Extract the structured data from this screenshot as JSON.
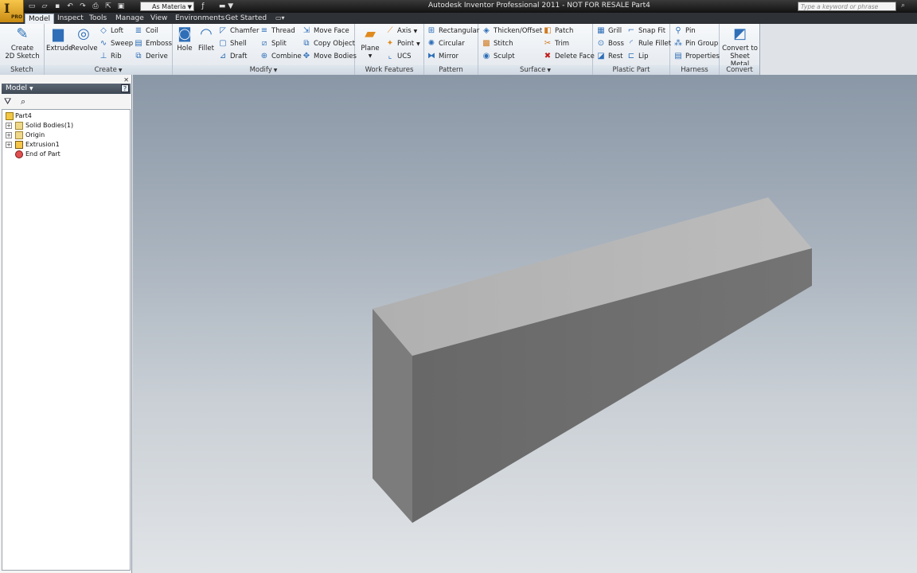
{
  "window": {
    "title": "Autodesk Inventor Professional 2011 - NOT FOR RESALE   Part4",
    "logo_text": "I",
    "logo_sub": "PRO"
  },
  "quick_access": {
    "material": "As Materia",
    "search_placeholder": "Type a keyword or phrase"
  },
  "tabs": [
    "Model",
    "Inspect",
    "Tools",
    "Manage",
    "View",
    "Environments",
    "Get Started"
  ],
  "ribbon": {
    "sketch": {
      "title": "Sketch",
      "create_2d_sketch": "Create\n2D Sketch"
    },
    "create": {
      "title": "Create",
      "extrude": "Extrude",
      "revolve": "Revolve",
      "loft": "Loft",
      "sweep": "Sweep",
      "rib": "Rib",
      "coil": "Coil",
      "emboss": "Emboss",
      "derive": "Derive"
    },
    "modify": {
      "title": "Modify",
      "hole": "Hole",
      "fillet": "Fillet",
      "chamfer": "Chamfer",
      "shell": "Shell",
      "draft": "Draft",
      "thread": "Thread",
      "split": "Split",
      "combine": "Combine",
      "move_face": "Move Face",
      "copy_object": "Copy Object",
      "move_bodies": "Move Bodies"
    },
    "work_features": {
      "title": "Work Features",
      "plane": "Plane",
      "axis": "Axis",
      "point": "Point",
      "ucs": "UCS"
    },
    "pattern": {
      "title": "Pattern",
      "rectangular": "Rectangular",
      "circular": "Circular",
      "mirror": "Mirror"
    },
    "surface": {
      "title": "Surface",
      "thicken_offset": "Thicken/Offset",
      "stitch": "Stitch",
      "sculpt": "Sculpt",
      "patch": "Patch",
      "trim": "Trim",
      "delete_face": "Delete Face"
    },
    "plastic_part": {
      "title": "Plastic Part",
      "grill": "Grill",
      "boss": "Boss",
      "rest": "Rest",
      "snap_fit": "Snap Fit",
      "rule_fillet": "Rule Fillet",
      "lip": "Lip"
    },
    "harness": {
      "title": "Harness",
      "pin": "Pin",
      "pin_group": "Pin Group",
      "properties": "Properties"
    },
    "convert": {
      "title": "Convert",
      "convert_to_sheet_metal": "Convert to\nSheet Metal"
    }
  },
  "browser": {
    "header": "Model",
    "tree": [
      {
        "label": "Part4"
      },
      {
        "label": "Solid Bodies(1)"
      },
      {
        "label": "Origin"
      },
      {
        "label": "Extrusion1"
      },
      {
        "label": "End of Part"
      }
    ]
  },
  "colors": {
    "accent": "#3d4855",
    "face_top": "#b3b3b3",
    "face_front": "#6e6e6e",
    "face_left": "#7d7d7d"
  }
}
